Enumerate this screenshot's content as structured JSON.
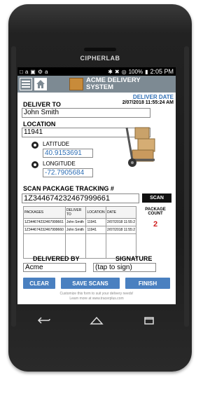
{
  "device": {
    "brand": "CIPHERLAB"
  },
  "statusbar": {
    "battery": "100%",
    "time": "2:05 PM"
  },
  "app": {
    "title_line1": "ACME DELIVERY",
    "title_line2": "SYSTEM"
  },
  "deliver_date": {
    "label": "DELIVER DATE",
    "value": "2/07/2018 11:55:24 AM"
  },
  "deliver_to": {
    "label": "DELIVER TO",
    "value": "John Smith"
  },
  "location": {
    "label": "LOCATION",
    "value": "11941",
    "latitude_label": "LATITUDE",
    "latitude": "40.9153691",
    "longitude_label": "LONGITUDE",
    "longitude": "-72.7905684"
  },
  "scan": {
    "label": "SCAN PACKAGE TRACKING #",
    "value": "1Z344674232467999661",
    "button": "SCAN"
  },
  "table": {
    "headers": [
      "PACKAGES",
      "DELIVER TO",
      "LOCATION",
      "DATE"
    ],
    "rows": [
      [
        "1Z344674232467999661",
        "John Smith",
        "11941",
        "2/07/2018 11:55:2"
      ],
      [
        "1Z344674232467999660",
        "John Smith",
        "11941",
        "2/07/2018 11:55:2"
      ]
    ]
  },
  "package_count": {
    "label_line1": "PACKAGE",
    "label_line2": "COUNT",
    "value": "2"
  },
  "delivered_by": {
    "label": "DELIVERED BY",
    "value": "Acme"
  },
  "signature": {
    "label": "SIGNATURE",
    "placeholder": "(tap to sign)"
  },
  "buttons": {
    "clear": "CLEAR",
    "save": "SAVE SCANS",
    "finish": "FINISH"
  },
  "footer": {
    "line1": "Customize this form to suit your delivery needs!",
    "line2": "Learn more at www.tracerplus.com"
  }
}
